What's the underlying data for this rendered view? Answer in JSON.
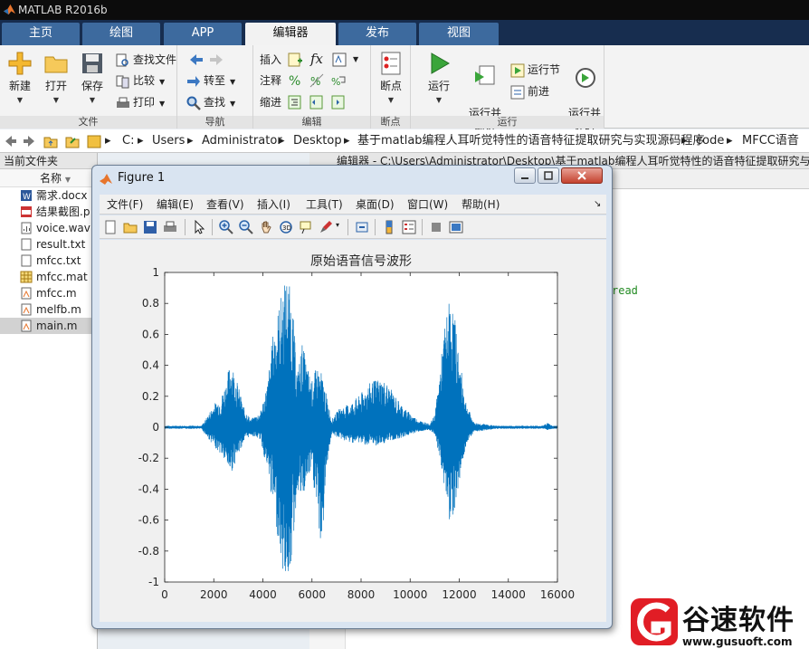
{
  "app": {
    "title": "MATLAB R2016b"
  },
  "tabs": [
    "主页",
    "绘图",
    "APP",
    "编辑器",
    "发布",
    "视图"
  ],
  "ribbon": {
    "file": {
      "label": "文件",
      "new": "新建",
      "open": "打开",
      "save": "保存",
      "find_files": "查找文件",
      "compare": "比较",
      "print": "打印"
    },
    "navigate": {
      "label": "导航",
      "goto": "转至",
      "find": "查找"
    },
    "edit": {
      "label": "编辑",
      "insert": "插入",
      "comment": "注释",
      "indent": "缩进",
      "fx": "fx"
    },
    "breakpoints": {
      "label": "断点",
      "breakpoints": "断点"
    },
    "run": {
      "label": "运行",
      "run": "运行",
      "run_advance": "运行并\n前进",
      "run_section": "运行节",
      "advance": "前进",
      "run_time": "运行并\n计时"
    }
  },
  "address": {
    "crumbs": [
      "C:",
      "Users",
      "Administrator",
      "Desktop",
      "基于matlab编程人耳听觉特性的语音特征提取研究与实现源码程序",
      "code",
      "MFCC语音"
    ]
  },
  "current_folder": {
    "title": "当前文件夹",
    "column": "名称",
    "files": [
      {
        "name": "需求.docx",
        "icon": "word-doc-icon"
      },
      {
        "name": "结果截图.p",
        "icon": "png-image-icon"
      },
      {
        "name": "voice.wav",
        "icon": "audio-file-icon"
      },
      {
        "name": "result.txt",
        "icon": "text-file-icon"
      },
      {
        "name": "mfcc.txt",
        "icon": "text-file-icon"
      },
      {
        "name": "mfcc.mat",
        "icon": "mat-file-icon"
      },
      {
        "name": "mfcc.m",
        "icon": "m-file-icon"
      },
      {
        "name": "melfb.m",
        "icon": "m-file-icon"
      },
      {
        "name": "main.m",
        "icon": "m-file-icon",
        "selected": true
      }
    ]
  },
  "editor": {
    "title": "编辑器 - C:\\Users\\Administrator\\Desktop\\基于matlab编程人耳听觉特性的语音特征提取研究与实",
    "code_fragment": "read"
  },
  "figure": {
    "title": "Figure 1",
    "menu": [
      "文件(F)",
      "编辑(E)",
      "查看(V)",
      "插入(I)",
      "工具(T)",
      "桌面(D)",
      "窗口(W)",
      "帮助(H)"
    ]
  },
  "chart_data": {
    "type": "line",
    "title": "原始语音信号波形",
    "xlabel": "",
    "ylabel": "",
    "xlim": [
      0,
      16000
    ],
    "ylim": [
      -1,
      1
    ],
    "xticks": [
      0,
      2000,
      4000,
      6000,
      8000,
      10000,
      12000,
      14000,
      16000
    ],
    "yticks": [
      -1,
      -0.8,
      -0.6,
      -0.4,
      -0.2,
      0,
      0.2,
      0.4,
      0.6,
      0.8,
      1
    ],
    "grid": false,
    "color": "#0072bd",
    "envelope": [
      {
        "x": 0,
        "lo": -0.01,
        "hi": 0.01
      },
      {
        "x": 1500,
        "lo": -0.01,
        "hi": 0.01
      },
      {
        "x": 1700,
        "lo": -0.06,
        "hi": 0.06
      },
      {
        "x": 2000,
        "lo": -0.12,
        "hi": 0.15
      },
      {
        "x": 2300,
        "lo": -0.18,
        "hi": 0.2
      },
      {
        "x": 2500,
        "lo": -0.25,
        "hi": 0.3
      },
      {
        "x": 2700,
        "lo": -0.3,
        "hi": 0.45
      },
      {
        "x": 2900,
        "lo": -0.22,
        "hi": 0.33
      },
      {
        "x": 3200,
        "lo": -0.1,
        "hi": 0.14
      },
      {
        "x": 3500,
        "lo": -0.05,
        "hi": 0.05
      },
      {
        "x": 3900,
        "lo": -0.08,
        "hi": 0.1
      },
      {
        "x": 4200,
        "lo": -0.3,
        "hi": 0.3
      },
      {
        "x": 4400,
        "lo": -0.5,
        "hi": 0.6
      },
      {
        "x": 4600,
        "lo": -0.7,
        "hi": 0.75
      },
      {
        "x": 4800,
        "lo": -0.95,
        "hi": 0.9
      },
      {
        "x": 5000,
        "lo": -1,
        "hi": 1
      },
      {
        "x": 5200,
        "lo": -0.85,
        "hi": 0.8
      },
      {
        "x": 5400,
        "lo": -0.4,
        "hi": 0.35
      },
      {
        "x": 5600,
        "lo": -0.5,
        "hi": 0.55
      },
      {
        "x": 5800,
        "lo": -0.35,
        "hi": 0.4
      },
      {
        "x": 6000,
        "lo": -0.3,
        "hi": 0.3
      },
      {
        "x": 6200,
        "lo": -0.55,
        "hi": 0.4
      },
      {
        "x": 6400,
        "lo": -0.83,
        "hi": 0.35
      },
      {
        "x": 6600,
        "lo": -0.25,
        "hi": 0.2
      },
      {
        "x": 6800,
        "lo": -0.05,
        "hi": 0.05
      },
      {
        "x": 7100,
        "lo": -0.07,
        "hi": 0.12
      },
      {
        "x": 7500,
        "lo": -0.1,
        "hi": 0.15
      },
      {
        "x": 7900,
        "lo": -0.1,
        "hi": 0.2
      },
      {
        "x": 8300,
        "lo": -0.12,
        "hi": 0.28
      },
      {
        "x": 8700,
        "lo": -0.12,
        "hi": 0.32
      },
      {
        "x": 9000,
        "lo": -0.1,
        "hi": 0.3
      },
      {
        "x": 9400,
        "lo": -0.08,
        "hi": 0.2
      },
      {
        "x": 9800,
        "lo": -0.06,
        "hi": 0.12
      },
      {
        "x": 10300,
        "lo": -0.03,
        "hi": 0.05
      },
      {
        "x": 10800,
        "lo": -0.02,
        "hi": 0.02
      },
      {
        "x": 11000,
        "lo": -0.05,
        "hi": 0.08
      },
      {
        "x": 11200,
        "lo": -0.2,
        "hi": 0.35
      },
      {
        "x": 11400,
        "lo": -0.4,
        "hi": 0.65
      },
      {
        "x": 11600,
        "lo": -0.6,
        "hi": 0.83
      },
      {
        "x": 11800,
        "lo": -0.55,
        "hi": 0.75
      },
      {
        "x": 12000,
        "lo": -0.35,
        "hi": 0.45
      },
      {
        "x": 12300,
        "lo": -0.1,
        "hi": 0.15
      },
      {
        "x": 12600,
        "lo": -0.03,
        "hi": 0.03
      },
      {
        "x": 13500,
        "lo": -0.01,
        "hi": 0.01
      },
      {
        "x": 15400,
        "lo": -0.01,
        "hi": 0.01
      },
      {
        "x": 15600,
        "lo": -0.02,
        "hi": 0.03
      },
      {
        "x": 15800,
        "lo": -0.01,
        "hi": 0.01
      },
      {
        "x": 16000,
        "lo": -0.01,
        "hi": 0.01
      }
    ]
  },
  "watermark": {
    "name": "谷速软件",
    "url": "www.gusuoft.com"
  }
}
